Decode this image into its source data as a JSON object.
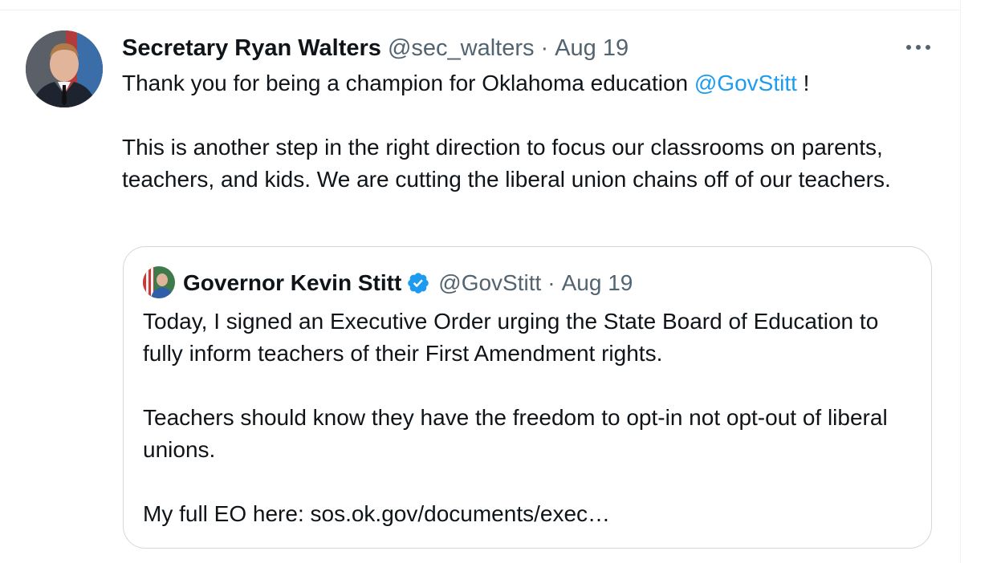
{
  "tweet": {
    "display_name": "Secretary Ryan Walters",
    "handle": "@sec_walters",
    "separator": "·",
    "date": "Aug 19",
    "more_icon": "more-horizontal-icon",
    "line1_prefix": "Thank you for being a champion for Oklahoma education ",
    "line1_mention": "@GovStitt",
    "line1_suffix": " !",
    "line2": "This is another step in the right direction to focus our classrooms on parents, teachers, and kids. We are cutting the liberal union chains off of our teachers."
  },
  "quote": {
    "display_name": "Governor Kevin Stitt",
    "verified_icon": "verified-badge-icon",
    "handle": "@GovStitt",
    "separator": "·",
    "date": "Aug 19",
    "paragraph1": "Today, I signed an Executive Order urging the State Board of Education to fully inform teachers of their First Amendment rights.",
    "paragraph2": "Teachers should know they have the freedom to opt-in not opt-out of liberal unions.",
    "paragraph3": "My full EO here: sos.ok.gov/documents/exec…"
  },
  "colors": {
    "link": "#1d9bf0",
    "secondary_text": "#536471",
    "border": "#cfd9de"
  }
}
